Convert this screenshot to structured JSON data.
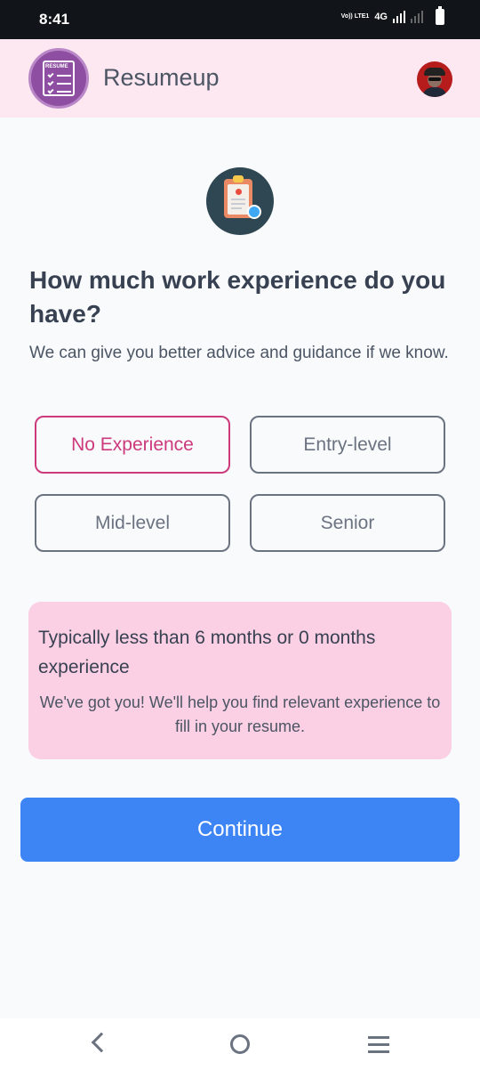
{
  "status_bar": {
    "time": "8:41",
    "volte": "Vo)) LTE1",
    "network": "4G"
  },
  "header": {
    "app_name": "Resumeup",
    "logo_text": "RESUME"
  },
  "question": {
    "title": "How much work experience do you have?",
    "subtitle": "We can give you better advice and guidance if we know."
  },
  "options": [
    {
      "label": "No Experience",
      "selected": true
    },
    {
      "label": "Entry-level",
      "selected": false
    },
    {
      "label": "Mid-level",
      "selected": false
    },
    {
      "label": "Senior",
      "selected": false
    }
  ],
  "info": {
    "title": "Typically less than 6 months or 0 months experience",
    "description": "We've got you! We'll help you find relevant experience to fill in your resume."
  },
  "continue_label": "Continue",
  "colors": {
    "accent": "#3d85f5",
    "selected": "#cc3a7c",
    "info_bg": "#fbcfe4",
    "header_bg": "#fde8f2"
  },
  "icons": [
    "clipboard-check-icon",
    "back-icon",
    "home-icon",
    "recents-icon"
  ]
}
